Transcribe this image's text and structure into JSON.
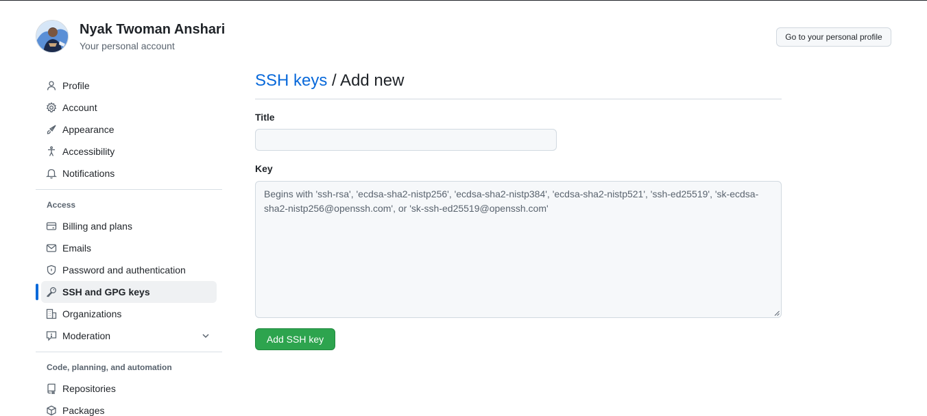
{
  "user": {
    "name": "Nyak Twoman Anshari",
    "subtitle": "Your personal account",
    "profile_button": "Go to your personal profile"
  },
  "sidebar": {
    "items": [
      {
        "label": "Profile",
        "icon": "person-icon"
      },
      {
        "label": "Account",
        "icon": "gear-icon"
      },
      {
        "label": "Appearance",
        "icon": "paintbrush-icon"
      },
      {
        "label": "Accessibility",
        "icon": "accessibility-icon"
      },
      {
        "label": "Notifications",
        "icon": "bell-icon"
      }
    ],
    "access_heading": "Access",
    "access_items": [
      {
        "label": "Billing and plans",
        "icon": "credit-card-icon"
      },
      {
        "label": "Emails",
        "icon": "mail-icon"
      },
      {
        "label": "Password and authentication",
        "icon": "shield-lock-icon"
      },
      {
        "label": "SSH and GPG keys",
        "icon": "key-icon",
        "active": true
      },
      {
        "label": "Organizations",
        "icon": "organization-icon"
      },
      {
        "label": "Moderation",
        "icon": "report-icon"
      }
    ],
    "code_heading": "Code, planning, and automation",
    "code_items": [
      {
        "label": "Repositories",
        "icon": "repo-icon"
      },
      {
        "label": "Packages",
        "icon": "package-icon"
      }
    ]
  },
  "main": {
    "breadcrumb_link": "SSH keys",
    "title_suffix": " / Add new",
    "title_label": "Title",
    "title_value": "",
    "key_label": "Key",
    "key_placeholder": "Begins with 'ssh-rsa', 'ecdsa-sha2-nistp256', 'ecdsa-sha2-nistp384', 'ecdsa-sha2-nistp521', 'ssh-ed25519', 'sk-ecdsa-sha2-nistp256@openssh.com', or 'sk-ssh-ed25519@openssh.com'",
    "submit_label": "Add SSH key"
  },
  "colors": {
    "accent": "#0969da",
    "primary_button": "#2da44e",
    "active_bg": "#eff1f3"
  }
}
